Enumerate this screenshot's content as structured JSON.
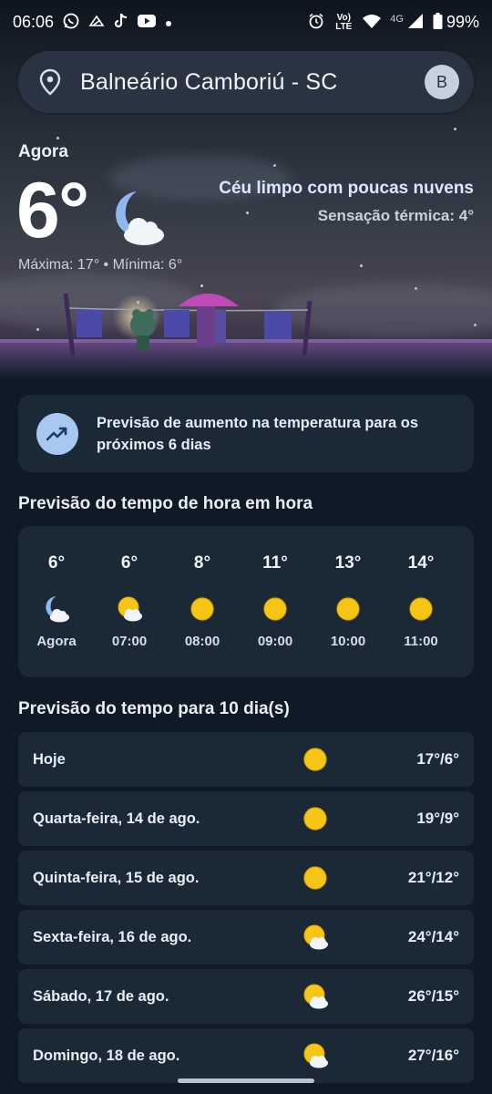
{
  "status_bar": {
    "time": "06:06",
    "battery": "99%",
    "network": "4G",
    "volte": "Vo) LTE",
    "left_icons": [
      "whatsapp-icon",
      "bird-icon",
      "tiktok-icon",
      "youtube-icon",
      "dot-icon"
    ],
    "right_icons": [
      "alarm-icon",
      "volte-icon",
      "wifi-icon",
      "signal-icon",
      "battery-icon"
    ]
  },
  "search": {
    "location": "Balneário Camboriú - SC",
    "avatar_letter": "B"
  },
  "current": {
    "label": "Agora",
    "temp": "6°",
    "condition": "Céu limpo com poucas nuvens",
    "feels_like": "Sensação térmica: 4°",
    "max_min": "Máxima: 17° • Mínima: 6°",
    "icon": "moon-cloud-icon"
  },
  "trend": {
    "text": "Previsão de aumento na temperatura para os próximos 6 dias",
    "icon": "trending-up-icon"
  },
  "hourly": {
    "title": "Previsão do tempo de hora em hora",
    "items": [
      {
        "temp": "6°",
        "time": "Agora",
        "icon": "moon-cloud-icon"
      },
      {
        "temp": "6°",
        "time": "07:00",
        "icon": "sun-cloud-icon"
      },
      {
        "temp": "8°",
        "time": "08:00",
        "icon": "sun-icon"
      },
      {
        "temp": "11°",
        "time": "09:00",
        "icon": "sun-icon"
      },
      {
        "temp": "13°",
        "time": "10:00",
        "icon": "sun-icon"
      },
      {
        "temp": "14°",
        "time": "11:00",
        "icon": "sun-icon"
      }
    ]
  },
  "daily": {
    "title": "Previsão do tempo para 10 dia(s)",
    "items": [
      {
        "day": "Hoje",
        "temps": "17°/6°",
        "icon": "sun-icon"
      },
      {
        "day": "Quarta-feira, 14 de ago.",
        "temps": "19°/9°",
        "icon": "sun-icon"
      },
      {
        "day": "Quinta-feira, 15 de ago.",
        "temps": "21°/12°",
        "icon": "sun-icon"
      },
      {
        "day": "Sexta-feira, 16 de ago.",
        "temps": "24°/14°",
        "icon": "sun-cloud-icon"
      },
      {
        "day": "Sábado, 17 de ago.",
        "temps": "26°/15°",
        "icon": "sun-cloud-icon"
      },
      {
        "day": "Domingo, 18 de ago.",
        "temps": "27°/16°",
        "icon": "sun-cloud-icon"
      }
    ]
  },
  "colors": {
    "background": "#0f1a26",
    "card": "#1b2835",
    "search_bg": "#2a3341",
    "sun": "#f5c518",
    "accent_blue": "#a9c8f1"
  }
}
